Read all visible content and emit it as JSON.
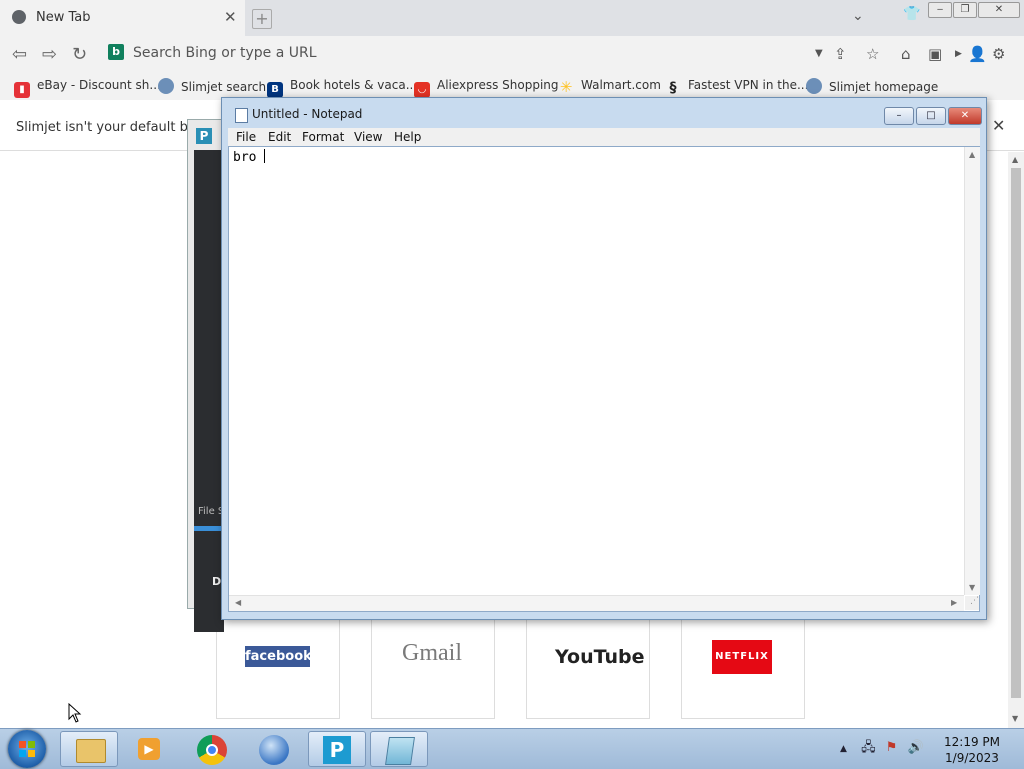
{
  "browser": {
    "tab_title": "New Tab",
    "omnibox_placeholder": "Search Bing or type a URL",
    "bookmarks": [
      {
        "label": "eBay - Discount sh...",
        "icon": "ebay-bag-icon"
      },
      {
        "label": "Slimjet search",
        "icon": "slimjet-icon"
      },
      {
        "label": "Book hotels & vaca...",
        "icon": "booking-icon"
      },
      {
        "label": "Aliexpress Shopping",
        "icon": "aliexpress-icon"
      },
      {
        "label": "Walmart.com",
        "icon": "walmart-icon"
      },
      {
        "label": "Fastest VPN in the...",
        "icon": "vpn-icon"
      },
      {
        "label": "Slimjet homepage",
        "icon": "slimjet-icon"
      }
    ],
    "infobar_text": "Slimjet isn't your default brow",
    "speed_dial": [
      "facebook",
      "Gmail",
      "YouTube",
      "NETFLIX"
    ]
  },
  "background_window": {
    "file_text": "File S",
    "d_text": "D"
  },
  "notepad": {
    "title": "Untitled - Notepad",
    "menu": [
      "File",
      "Edit",
      "Format",
      "View",
      "Help"
    ],
    "content": "bro "
  },
  "taskbar": {
    "time": "12:19 PM",
    "date": "1/9/2023"
  },
  "colors": {
    "facebook": "#3b5998",
    "netflix": "#e50914",
    "youtube_red": "#e52d27",
    "bing": "#10805d"
  }
}
